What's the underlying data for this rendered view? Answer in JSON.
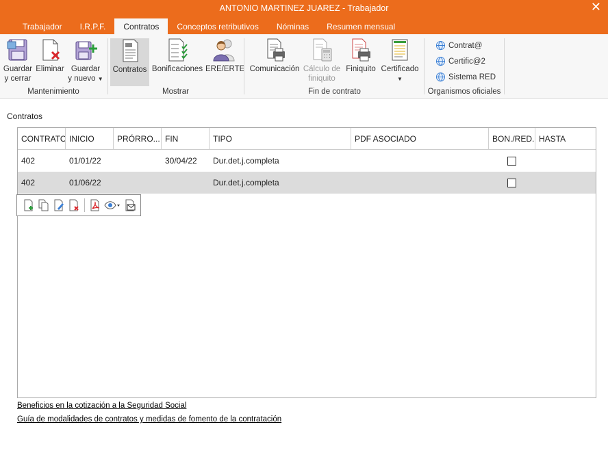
{
  "window": {
    "title": "ANTONIO MARTINEZ JUAREZ - Trabajador",
    "close_symbol": "✕"
  },
  "tabs": [
    {
      "label": "Trabajador"
    },
    {
      "label": "I.R.P.F."
    },
    {
      "label": "Contratos",
      "active": true
    },
    {
      "label": "Conceptos retributivos"
    },
    {
      "label": "Nóminas"
    },
    {
      "label": "Resumen mensual"
    }
  ],
  "ribbon": {
    "mantenimiento": {
      "label": "Mantenimiento",
      "guardar_cerrar": {
        "line1": "Guardar",
        "line2": "y cerrar"
      },
      "eliminar": {
        "line1": "Eliminar"
      },
      "guardar_nuevo": {
        "line1": "Guardar",
        "line2": "y nuevo"
      }
    },
    "mostrar": {
      "label": "Mostrar",
      "contratos": "Contratos",
      "bonificaciones": "Bonificaciones",
      "ere": "ERE/ERTE"
    },
    "fin_contrato": {
      "label": "Fin de contrato",
      "comunicacion": "Comunicación",
      "calculo": {
        "line1": "Cálculo de",
        "line2": "finiquito"
      },
      "finiquito": "Finiquito",
      "certificado": "Certificado"
    },
    "organismos": {
      "label": "Organismos oficiales",
      "contrata": "Contrat@",
      "certifica": "Certific@2",
      "red": "Sistema RED"
    }
  },
  "section_label": "Contratos",
  "table": {
    "headers": [
      "CONTRATO",
      "INICIO",
      "PRÓRRO...",
      "FIN",
      "TIPO",
      "PDF ASOCIADO",
      "BON./RED.",
      "HASTA"
    ],
    "rows": [
      {
        "contrato": "402",
        "inicio": "01/01/22",
        "prorroga": "",
        "fin": "30/04/22",
        "tipo": "Dur.det.j.completa",
        "pdf": "",
        "bon": false,
        "hasta": ""
      },
      {
        "contrato": "402",
        "inicio": "01/06/22",
        "prorroga": "",
        "fin": "",
        "tipo": "Dur.det.j.completa",
        "pdf": "",
        "bon": false,
        "hasta": "",
        "selected": true
      }
    ]
  },
  "links": {
    "beneficios": "Beneficios en la cotización a la Seguridad Social",
    "guia": "Guía de modalidades de contratos y medidas de fomento de la contratación"
  },
  "colors": {
    "accent": "#ec6c1c",
    "ribbon_bg": "#f7f7f7",
    "selected_row": "#dcdcdc"
  }
}
